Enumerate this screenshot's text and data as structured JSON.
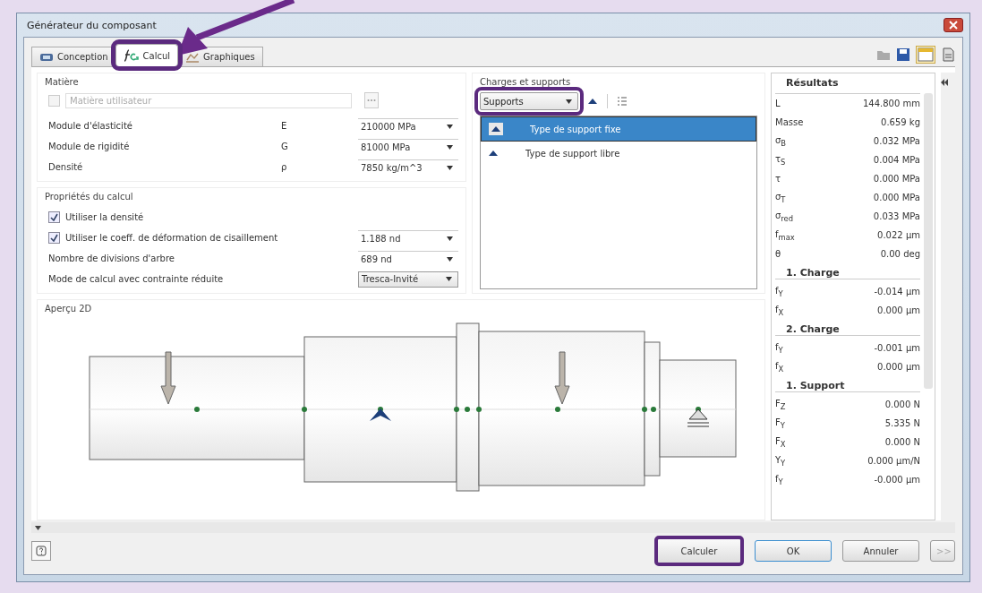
{
  "window": {
    "title": "Générateur du composant"
  },
  "tabs": [
    {
      "label": "Conception",
      "selected": false,
      "highlighted": false
    },
    {
      "label": "Calcul",
      "selected": true,
      "highlighted": true
    },
    {
      "label": "Graphiques",
      "selected": false,
      "highlighted": false
    }
  ],
  "material": {
    "title": "Matière",
    "user_material": {
      "label": "Matière utilisateur",
      "checked": false,
      "disabled": true
    },
    "rows": [
      {
        "label": "Module d'élasticité",
        "symbol": "E",
        "value": "210000 MPa"
      },
      {
        "label": "Module de rigidité",
        "symbol": "G",
        "value": "81000 MPa"
      },
      {
        "label": "Densité",
        "symbol": "ρ",
        "value": "7850 kg/m^3"
      }
    ]
  },
  "calc_properties": {
    "title": "Propriétés du calcul",
    "rows": [
      {
        "kind": "checkbox",
        "label": "Utiliser la densité",
        "checked": true
      },
      {
        "kind": "checkbox",
        "label": "Utiliser le coeff. de déformation de cisaillement",
        "checked": true,
        "value": "1.188 nd"
      },
      {
        "kind": "spin",
        "label": "Nombre de divisions d'arbre",
        "value": "689 nd"
      },
      {
        "kind": "select",
        "label": "Mode de calcul avec contrainte réduite",
        "value": "Tresca-Invité"
      }
    ]
  },
  "loads": {
    "title": "Charges et supports",
    "dropdown": {
      "value": "Supports",
      "highlighted": true
    },
    "items": [
      {
        "label": "Type de support fixe",
        "selected": true
      },
      {
        "label": "Type de support libre",
        "selected": false
      }
    ]
  },
  "preview": {
    "title": "Aperçu 2D"
  },
  "results": {
    "title": "Résultats",
    "rows": [
      {
        "kind": "value",
        "label": "L",
        "value": "144.800 mm"
      },
      {
        "kind": "value",
        "label": "Masse",
        "value": "0.659 kg"
      },
      {
        "kind": "value",
        "label": "σ$_{B}$",
        "value": "0.032 MPa"
      },
      {
        "kind": "value",
        "label": "τ$_{S}$",
        "value": "0.004 MPa"
      },
      {
        "kind": "value",
        "label": "τ",
        "value": "0.000 MPa"
      },
      {
        "kind": "value",
        "label": "σ$_{T}$",
        "value": "0.000 MPa"
      },
      {
        "kind": "value",
        "label": "σ$_{red}$",
        "value": "0.033 MPa"
      },
      {
        "kind": "value",
        "label": "f$_{max}$",
        "value": "0.022 µm"
      },
      {
        "kind": "value",
        "label": "θ",
        "value": "0.00 deg"
      },
      {
        "kind": "header",
        "label": "1. Charge"
      },
      {
        "kind": "value",
        "label": "f$_{Y}$",
        "value": "-0.014 µm"
      },
      {
        "kind": "value",
        "label": "f$_{X}$",
        "value": "0.000 µm"
      },
      {
        "kind": "header",
        "label": "2. Charge"
      },
      {
        "kind": "value",
        "label": "f$_{Y}$",
        "value": "-0.001 µm"
      },
      {
        "kind": "value",
        "label": "f$_{X}$",
        "value": "0.000 µm"
      },
      {
        "kind": "header",
        "label": "1. Support"
      },
      {
        "kind": "value",
        "label": "F$_{Z}$",
        "value": "0.000 N"
      },
      {
        "kind": "value",
        "label": "F$_{Y}$",
        "value": "5.335 N"
      },
      {
        "kind": "value",
        "label": "F$_{X}$",
        "value": "0.000 N"
      },
      {
        "kind": "value",
        "label": "Y$_{Y}$",
        "value": "0.000 µm/N"
      },
      {
        "kind": "value",
        "label": "f$_{Y}$",
        "value": "-0.000 µm"
      }
    ]
  },
  "buttons": [
    {
      "label": "Calculer",
      "highlighted": true,
      "default": false,
      "disabled": false
    },
    {
      "label": "OK",
      "highlighted": false,
      "default": true,
      "disabled": false
    },
    {
      "label": "Annuler",
      "highlighted": false,
      "default": false,
      "disabled": false
    },
    {
      "label": ">>",
      "highlighted": false,
      "default": false,
      "disabled": true
    }
  ]
}
